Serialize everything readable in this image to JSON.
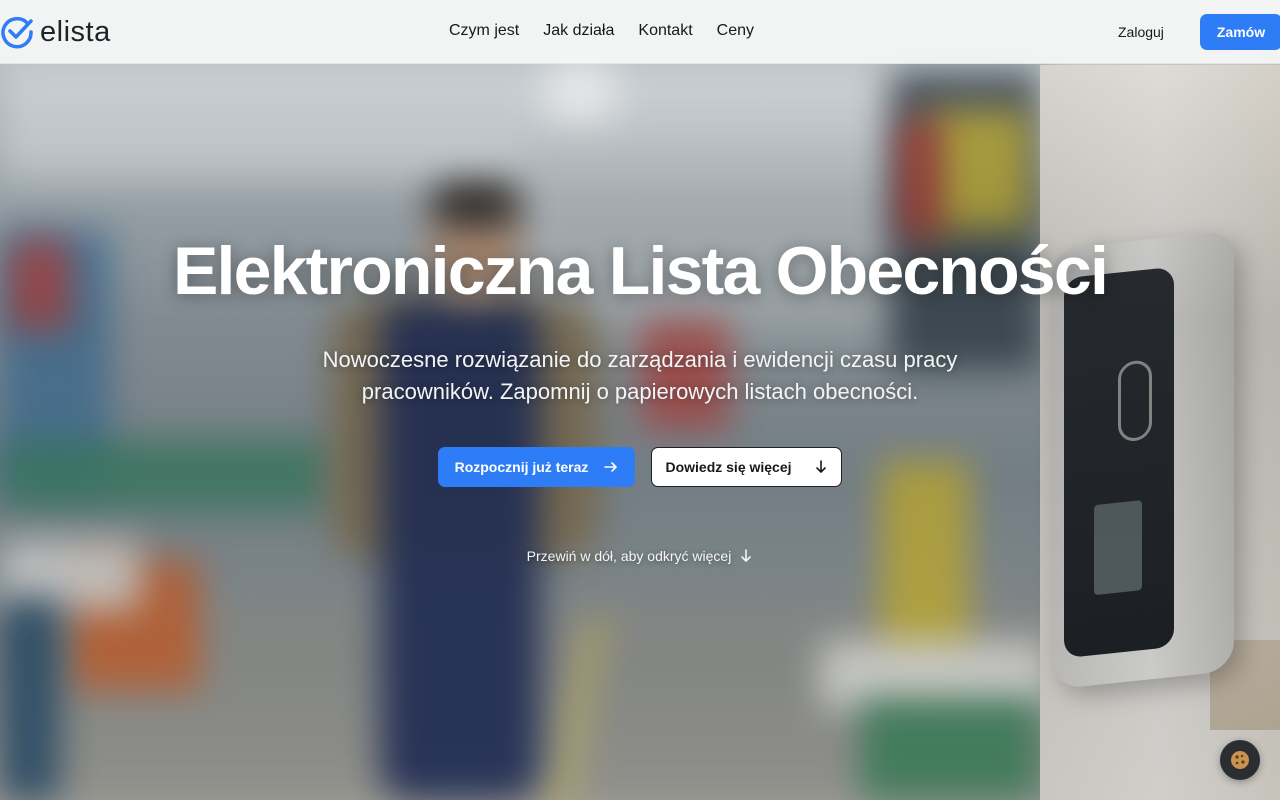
{
  "brand": {
    "name": "elista",
    "accent": "#2f7df6"
  },
  "nav": {
    "items": [
      {
        "label": "Czym jest"
      },
      {
        "label": "Jak działa"
      },
      {
        "label": "Kontakt"
      },
      {
        "label": "Ceny"
      }
    ],
    "login_label": "Zaloguj",
    "order_label": "Zamów"
  },
  "hero": {
    "title": "Elektroniczna Lista Obecności",
    "subtitle": "Nowoczesne rozwiązanie do zarządzania i ewidencji czasu pracy pracowników. Zapomnij o papierowych listach obecności.",
    "primary_cta": "Rozpocznij już teraz",
    "secondary_cta": "Dowiedz się więcej",
    "scroll_hint": "Przewiń w dół, aby odkryć więcej"
  },
  "icons": {
    "logo": "check-circle-icon",
    "primary_cta": "arrow-right-icon",
    "secondary_cta": "arrow-down-icon",
    "scroll_hint": "arrow-down-icon",
    "cookie": "cookie-icon"
  }
}
